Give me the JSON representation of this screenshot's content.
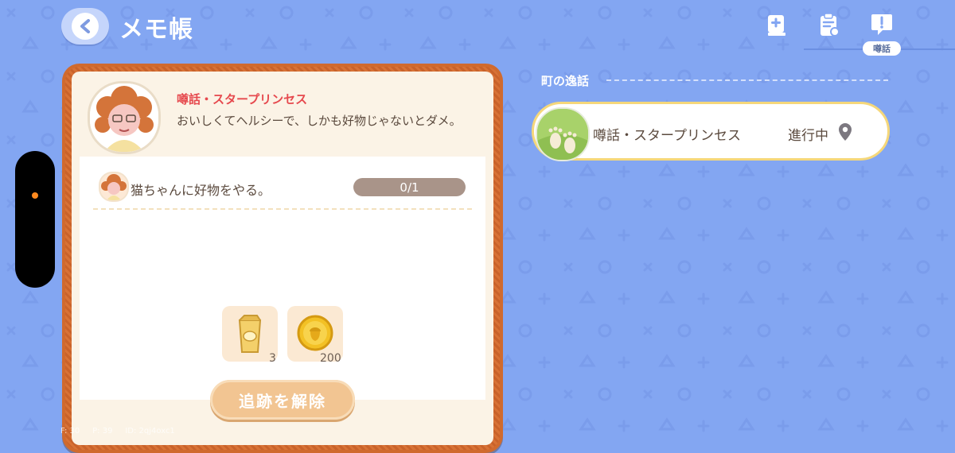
{
  "header": {
    "title": "メモ帳",
    "back_icon": "chevron-left-icon"
  },
  "tabs": [
    {
      "icon": "book-plus-icon",
      "active": false
    },
    {
      "icon": "clipboard-check-icon",
      "active": false
    },
    {
      "icon": "chat-exclamation-icon",
      "active": true,
      "label": "噂話"
    }
  ],
  "detail": {
    "npc_name": "噂話・スタープリンセス",
    "description": "おいしくてヘルシーで、しかも好物じゃないとダメ。",
    "task": {
      "text": "猫ちゃんに好物をやる。",
      "progress": "0/1",
      "progress_fraction": 0.0
    },
    "rewards": [
      {
        "icon": "food-bag-icon",
        "count": "3"
      },
      {
        "icon": "acorn-coin-icon",
        "count": "200"
      }
    ],
    "untrack_label": "追跡を解除"
  },
  "sidebar": {
    "section_title": "町の逸話",
    "items": [
      {
        "name": "噂話・スタープリンセス",
        "status": "進行中",
        "icon": "location-pin-icon"
      }
    ]
  },
  "debug": "F: 30     P: 39     ID: 2qj4oxc1",
  "colors": {
    "background": "#83a6f2",
    "card_frame": "#d06a2e",
    "npc_name": "#e6494e",
    "highlight_border": "#f5d77a",
    "button": "#f2c592"
  }
}
